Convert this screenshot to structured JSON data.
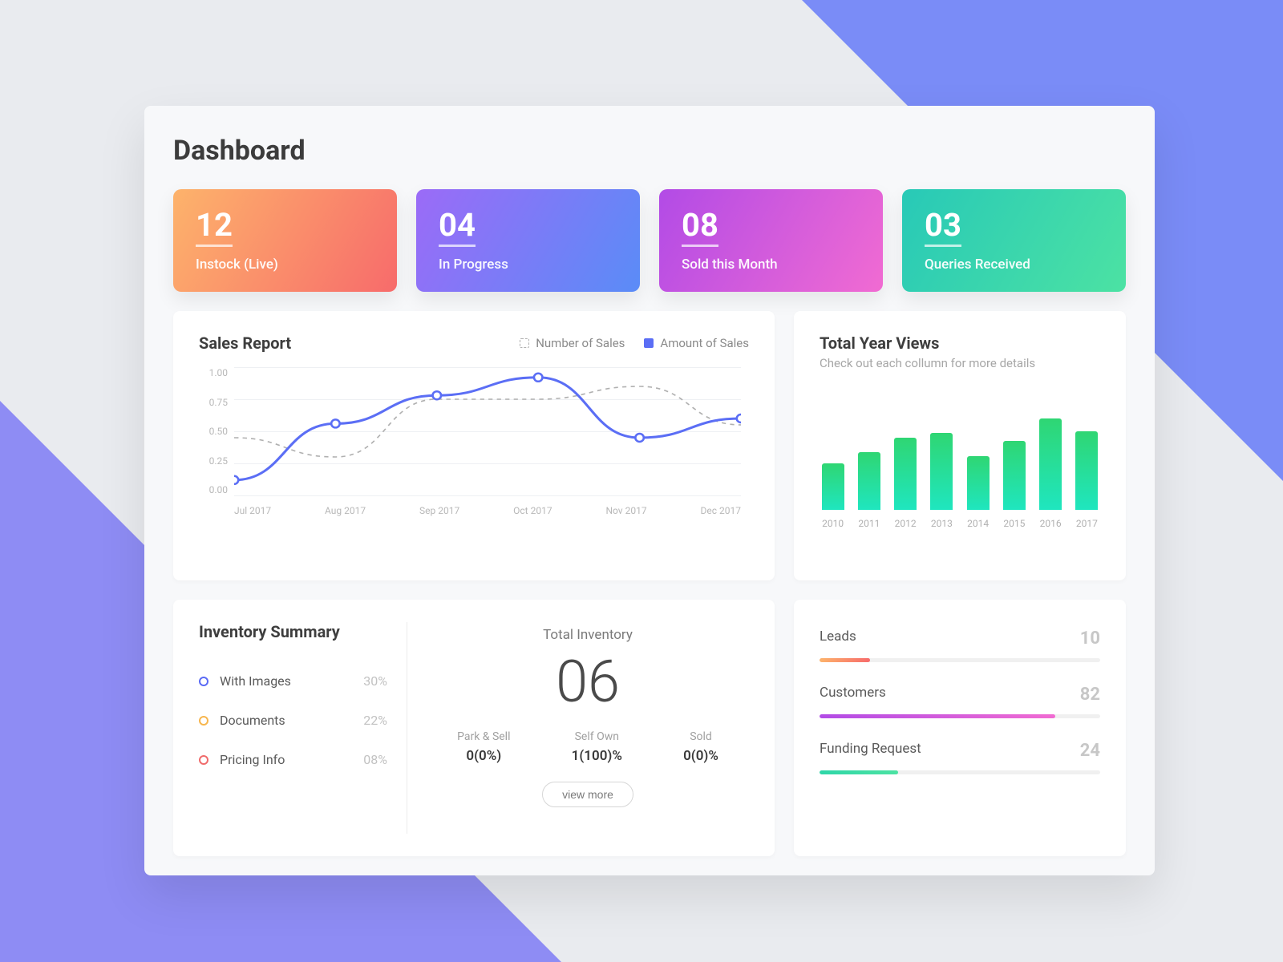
{
  "page": {
    "title": "Dashboard"
  },
  "stats": [
    {
      "value": "12",
      "label": "Instock (Live)"
    },
    {
      "value": "04",
      "label": "In Progress"
    },
    {
      "value": "08",
      "label": "Sold this Month"
    },
    {
      "value": "03",
      "label": "Queries Received"
    }
  ],
  "sales": {
    "title": "Sales Report",
    "legend": {
      "number": "Number of Sales",
      "amount": "Amount of Sales"
    },
    "legend_color": "#5b6ef5"
  },
  "views": {
    "title": "Total Year Views",
    "subtitle": "Check out each collumn for more details"
  },
  "chart_data": [
    {
      "type": "line",
      "title": "Sales Report",
      "x": [
        "Jul 2017",
        "Aug 2017",
        "Sep 2017",
        "Oct 2017",
        "Nov 2017",
        "Dec 2017"
      ],
      "y_ticks": [
        "1.00",
        "0.75",
        "0.50",
        "0.25",
        "0.00"
      ],
      "ylim": [
        0,
        1.0
      ],
      "series": [
        {
          "name": "Amount of Sales",
          "style": "solid",
          "color": "#5b6ef5",
          "values": [
            0.12,
            0.56,
            0.78,
            0.92,
            0.45,
            0.6
          ]
        },
        {
          "name": "Number of Sales",
          "style": "dashed",
          "color": "#b0b0b0",
          "values": [
            0.45,
            0.3,
            0.75,
            0.75,
            0.85,
            0.55
          ]
        }
      ]
    },
    {
      "type": "bar",
      "title": "Total Year Views",
      "categories": [
        "2010",
        "2011",
        "2012",
        "2013",
        "2014",
        "2015",
        "2016",
        "2017"
      ],
      "values": [
        48,
        60,
        75,
        80,
        56,
        72,
        95,
        82
      ],
      "ylim": [
        0,
        100
      ]
    }
  ],
  "inventory": {
    "title": "Inventory Summary",
    "items": [
      {
        "label": "With Images",
        "pct": "30%",
        "color": "#5a6af5"
      },
      {
        "label": "Documents",
        "pct": "22%",
        "color": "#f7b64e"
      },
      {
        "label": "Pricing Info",
        "pct": "08%",
        "color": "#f06b6b"
      }
    ],
    "total_label": "Total Inventory",
    "total_value": "06",
    "breakdown": [
      {
        "label": "Park & Sell",
        "value": "0(0%)"
      },
      {
        "label": "Self Own",
        "value": "1(100)%"
      },
      {
        "label": "Sold",
        "value": "0(0)%"
      }
    ],
    "view_more": "view more"
  },
  "metrics": [
    {
      "label": "Leads",
      "value": "10"
    },
    {
      "label": "Customers",
      "value": "82"
    },
    {
      "label": "Funding Request",
      "value": "24"
    }
  ]
}
